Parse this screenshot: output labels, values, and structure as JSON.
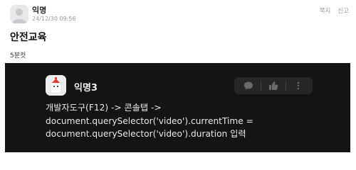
{
  "post": {
    "author": "익명",
    "timestamp": "24/12/30 09:56",
    "actions": {
      "report": "쪽지",
      "block": "신고"
    },
    "title": "안전교육",
    "subtitle": "5분컷"
  },
  "comment": {
    "author": "익명3",
    "lines": [
      "개발자도구(F12) -> 콘솔탭 ->",
      "document.querySelector('video').currentTime =",
      "document.querySelector('video').duration 입력"
    ],
    "icons": [
      "comment-icon",
      "like-icon",
      "more-icon"
    ]
  },
  "colors": {
    "embed_bg": "#141414",
    "accent": "#e23b2e"
  }
}
